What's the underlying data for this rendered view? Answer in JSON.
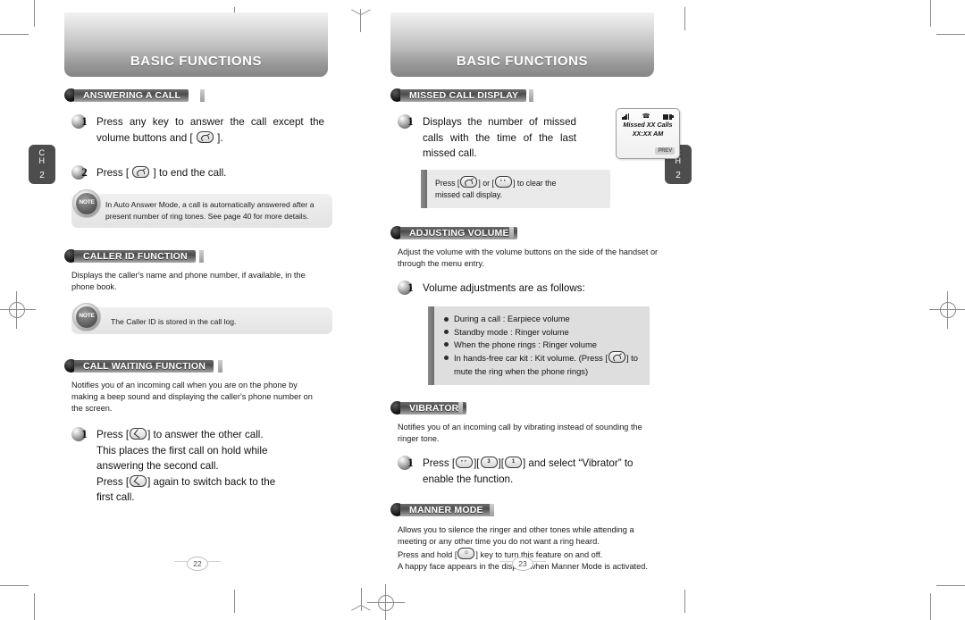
{
  "document": {
    "type": "phone-user-manual-spread",
    "chapter_tab": {
      "label_line1": "C",
      "label_line2": "H",
      "number": "2"
    }
  },
  "left_page": {
    "banner_title": "BASIC FUNCTIONS",
    "page_number": "22",
    "sections": [
      {
        "heading": "ANSWERING A CALL",
        "steps": [
          {
            "number": "1",
            "text_before": "Press any key to answer the call except the volume buttons and [",
            "key": "send-end-key",
            "text_after": "]."
          },
          {
            "number": "2",
            "text_before": "Press [",
            "key": "send-end-key",
            "text_after": "] to end the call."
          }
        ],
        "note": "In Auto Answer Mode, a call is automatically answered after a present number of ring tones. See page 40 for more details.",
        "note_badge": "NOTE"
      },
      {
        "heading": "CALLER ID FUNCTION",
        "intro": "Displays the caller's name and phone number, if available, in the phone book.",
        "note": "The Caller ID is stored in the call log.",
        "note_badge": "NOTE"
      },
      {
        "heading": "CALL WAITING FUNCTION",
        "intro": "Notifies you of an incoming call when you are on the phone by making a beep sound and displaying the caller's phone number on the screen.",
        "step": {
          "number": "1",
          "line1_a": "Press [",
          "line1_b": "] to answer the other call.",
          "line2": "This places the first call on hold while",
          "line3": "answering the second call.",
          "line4_a": "Press [",
          "line4_b": "] again to switch back to the",
          "line5": "first call."
        }
      }
    ]
  },
  "right_page": {
    "banner_title": "BASIC FUNCTIONS",
    "page_number": "23",
    "sections": [
      {
        "heading": "MISSED CALL DISPLAY",
        "step": {
          "number": "1",
          "text": "Displays the number of missed calls with the time of the last missed call."
        },
        "tip_a": "Press [",
        "tip_b": "] or [",
        "tip_c": "] to clear the",
        "tip_d": "missed call display.",
        "phone_display": {
          "signal_icon": "signal-bars-icon",
          "phone_icon": "☎",
          "battery_icon": "battery-icon",
          "line1": "Missed XX Calls",
          "line2": "XX:XX AM",
          "softkey": "PREV"
        }
      },
      {
        "heading": "ADJUSTING VOLUME",
        "intro": "Adjust the volume with the volume buttons on the side of the handset or through the menu entry.",
        "step": {
          "number": "1",
          "text": "Volume adjustments are as follows:"
        },
        "bullets": [
          "During a call : Earpiece volume",
          "Standby mode : Ringer volume",
          "When the phone rings : Ringer volume",
          "In hands-free car kit : Kit volume. (Press [",
          "] to",
          "mute the ring when the phone rings)"
        ]
      },
      {
        "heading": "VIBRATOR",
        "intro": "Notifies you of an incoming call by vibrating instead of sounding the ringer tone.",
        "step": {
          "number": "1",
          "a": "Press [",
          "b": "][",
          "c": "][",
          "d": "] and select “Vibrator” to",
          "e": "enable the function.",
          "key1": "dots-key",
          "key2": "3",
          "key3": "1"
        }
      },
      {
        "heading": "MANNER MODE",
        "body_line1": "Allows you to silence the ringer and other tones while attending a",
        "body_line2": "meeting or any other time you do not want a ring heard.",
        "body_line3_a": "Press and hold [",
        "body_line3_b": "] key to turn this feature on and off.",
        "body_line4": "A happy face appears in the display when Manner Mode is activated."
      }
    ]
  }
}
